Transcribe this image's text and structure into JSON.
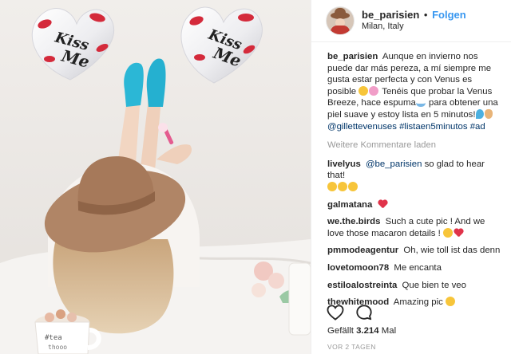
{
  "post": {
    "username": "be_parisien",
    "separator": "•",
    "follow_label": "Folgen",
    "location": "Milan, Italy"
  },
  "photo": {
    "balloon_text_left": "Kiss Me",
    "balloon_text_right": "Kiss Me",
    "mug_text_line1": "#tea",
    "mug_text_line2": "thooo"
  },
  "caption": {
    "username": "be_parisien",
    "text": "Aunque en invierno nos puede dar más pereza, a mí siempre me gusta estar perfecta y con Venus es posible",
    "text2": "Tenéis que probar la Venus Breeze, hace espuma",
    "text3": "para obtener una piel suave y estoy lista en 5 minutos!",
    "tags": "@gillettevenuses #listaen5minutos #ad"
  },
  "load_more": "Weitere Kommentare laden",
  "comments": [
    {
      "user": "livelyus",
      "mention": "@be_parisien",
      "text": "so glad to hear that!"
    },
    {
      "user": "galmatana",
      "text": ""
    },
    {
      "user": "we.the.birds",
      "text": "Such a cute pic ! And we love those macaron details !"
    },
    {
      "user": "pmmodeagentur",
      "text": "Oh, wie toll ist das denn"
    },
    {
      "user": "lovetomoon78",
      "text": "Me encanta"
    },
    {
      "user": "estiloalostreinta",
      "text": "Que bien te veo"
    },
    {
      "user": "thewhitemood",
      "text": "Amazing pic"
    }
  ],
  "likes": {
    "label": "Gefällt",
    "count": "3.214",
    "suffix": "Mal"
  },
  "time_ago": "VOR 2 TAGEN",
  "icons": {
    "like": "heart-outline-icon",
    "comment": "comment-bubble-icon"
  },
  "colors": {
    "accent": "#3897f0",
    "link": "#003569",
    "muted": "#999999",
    "heart": "#e0334a"
  }
}
